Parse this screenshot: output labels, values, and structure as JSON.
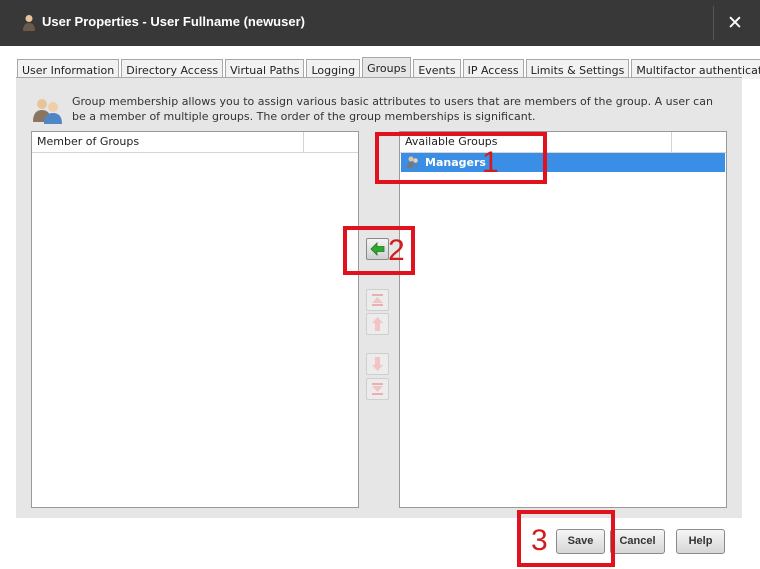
{
  "window": {
    "title": "User Properties - User Fullname (newuser)",
    "close_glyph": "✕"
  },
  "tabs": [
    {
      "label": "User Information",
      "active": false
    },
    {
      "label": "Directory Access",
      "active": false
    },
    {
      "label": "Virtual Paths",
      "active": false
    },
    {
      "label": "Logging",
      "active": false
    },
    {
      "label": "Groups",
      "active": true
    },
    {
      "label": "Events",
      "active": false
    },
    {
      "label": "IP Access",
      "active": false
    },
    {
      "label": "Limits & Settings",
      "active": false
    },
    {
      "label": "Multifactor authentication",
      "active": false
    }
  ],
  "groups": {
    "description": "Group membership allows you to assign various basic attributes to users that are members of the group. A user can be a member of multiple groups. The order of the group memberships is significant.",
    "member_header": "Member of Groups",
    "available_header": "Available Groups",
    "available_items": [
      {
        "label": "Managers",
        "selected": true
      }
    ],
    "icons": {
      "users": "users-icon",
      "add": "arrow-left-icon",
      "top": "move-top-icon",
      "up": "move-up-icon",
      "down": "move-down-icon",
      "bottom": "move-bottom-icon"
    }
  },
  "footer": {
    "save_label": "Save",
    "cancel_label": "Cancel",
    "help_label": "Help"
  },
  "annotations": [
    {
      "number": "1"
    },
    {
      "number": "2"
    },
    {
      "number": "3"
    }
  ],
  "colors": {
    "titlebar": "#383838",
    "selection": "#3a8ee6",
    "annotation": "#e0121d",
    "arrow_green": "#2ea82e"
  }
}
